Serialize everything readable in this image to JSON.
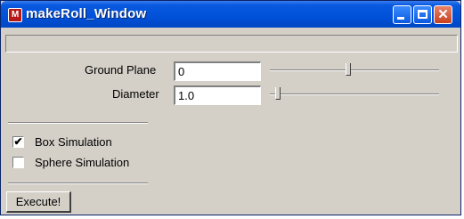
{
  "window": {
    "title": "makeRoll_Window"
  },
  "titlebar": {
    "app_icon": "maya-icon",
    "buttons": [
      "minimize-icon",
      "maximize-icon",
      "close-icon"
    ]
  },
  "status": {
    "text": ""
  },
  "fields": {
    "ground_plane": {
      "label": "Ground Plane",
      "value": "0",
      "slider_fraction": 0.46
    },
    "diameter": {
      "label": "Diameter",
      "value": "1.0",
      "slider_fraction": 0.03
    }
  },
  "options": {
    "box": {
      "label": "Box Simulation",
      "checked": true
    },
    "sphere": {
      "label": "Sphere Simulation",
      "checked": false
    }
  },
  "actions": {
    "execute_label": "Execute!"
  },
  "colors": {
    "titlebar": "#0050d8",
    "panel": "#d4d0c8",
    "close_button": "#c8401e"
  }
}
